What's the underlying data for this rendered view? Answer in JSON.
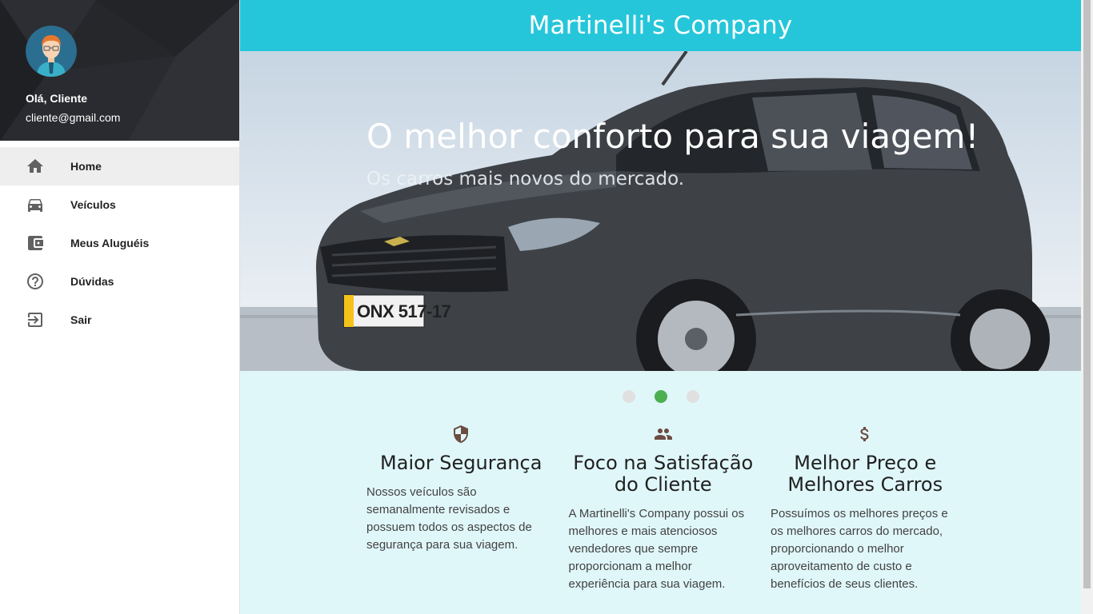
{
  "sidebar": {
    "user": {
      "greeting": "Olá, Cliente",
      "email": "cliente@gmail.com",
      "avatar_icon": "user-avatar-icon"
    },
    "items": [
      {
        "label": "Home",
        "icon": "home-icon",
        "active": true
      },
      {
        "label": "Veículos",
        "icon": "car-icon",
        "active": false
      },
      {
        "label": "Meus Aluguéis",
        "icon": "wallet-icon",
        "active": false
      },
      {
        "label": "Dúvidas",
        "icon": "help-icon",
        "active": false
      },
      {
        "label": "Sair",
        "icon": "logout-icon",
        "active": false
      }
    ]
  },
  "header": {
    "title": "Martinelli's Company"
  },
  "slider": {
    "title": "O melhor conforto para sua viagem!",
    "subtitle": "Os carros mais novos do mercado.",
    "plate": "ONX 517-17",
    "active_index": 1,
    "count": 3
  },
  "features": [
    {
      "icon": "security-shield-icon",
      "title": "Maior Segurança",
      "text": "Nossos veículos são semanalmente revisados e possuem todos os aspectos de segurança para sua viagem."
    },
    {
      "icon": "people-icon",
      "title": "Foco na Satisfação do Cliente",
      "text": "A Martinelli's Company possui os melhores e mais atenciosos vendedores que sempre proporcionam a melhor experiência para sua viagem."
    },
    {
      "icon": "dollar-icon",
      "title": "Melhor Preço e Melhores Carros",
      "text": "Possuímos os melhores preços e os melhores carros do mercado, proporcionando o melhor aproveitamento de custo e benefícios de seus clientes."
    }
  ],
  "colors": {
    "header": "#26c6da",
    "content_bg": "#e0f7fa",
    "indicator_active": "#4caf50",
    "icon_brown": "#6d4c41"
  }
}
